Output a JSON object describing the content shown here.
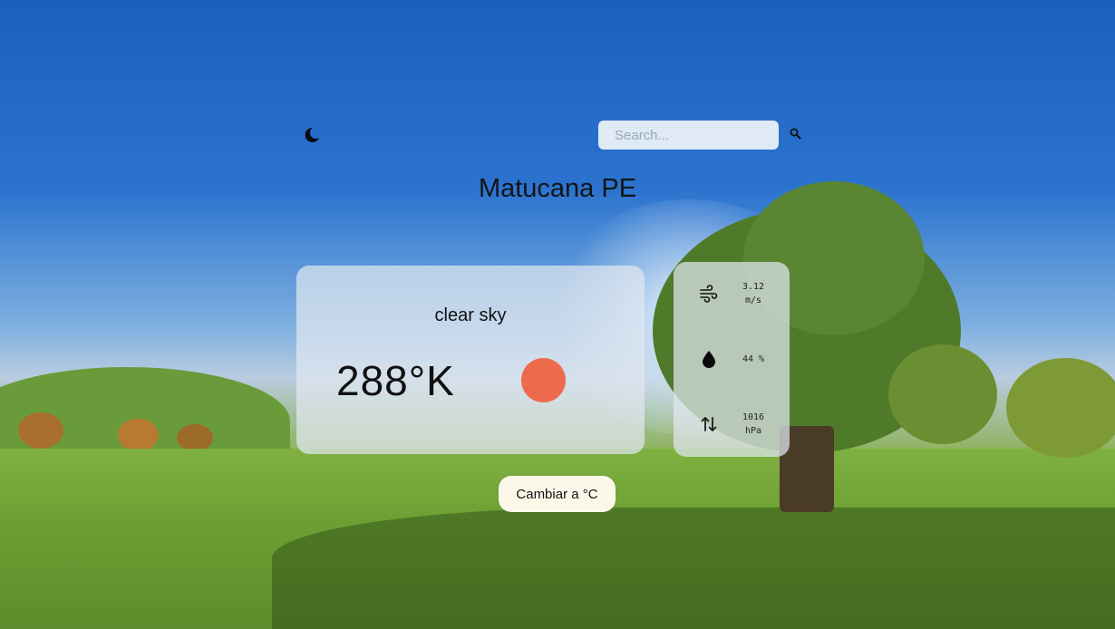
{
  "header": {
    "theme_toggle_icon": "moon-icon",
    "search": {
      "placeholder": "Search...",
      "value": "",
      "button_icon": "search-icon"
    }
  },
  "location": {
    "title": "Matucana PE"
  },
  "weather": {
    "description": "clear sky",
    "temperature": "288°K",
    "condition_icon": "sun-icon",
    "condition_icon_color": "#ee6a4c"
  },
  "stats": {
    "wind": {
      "icon": "wind-icon",
      "value": "3.12",
      "unit": "m/s"
    },
    "humidity": {
      "icon": "droplet-icon",
      "value": "44 %"
    },
    "pressure": {
      "icon": "pressure-arrows-icon",
      "value": "1016",
      "unit": "hPa"
    }
  },
  "actions": {
    "toggle_unit_label": "Cambiar a °C"
  }
}
